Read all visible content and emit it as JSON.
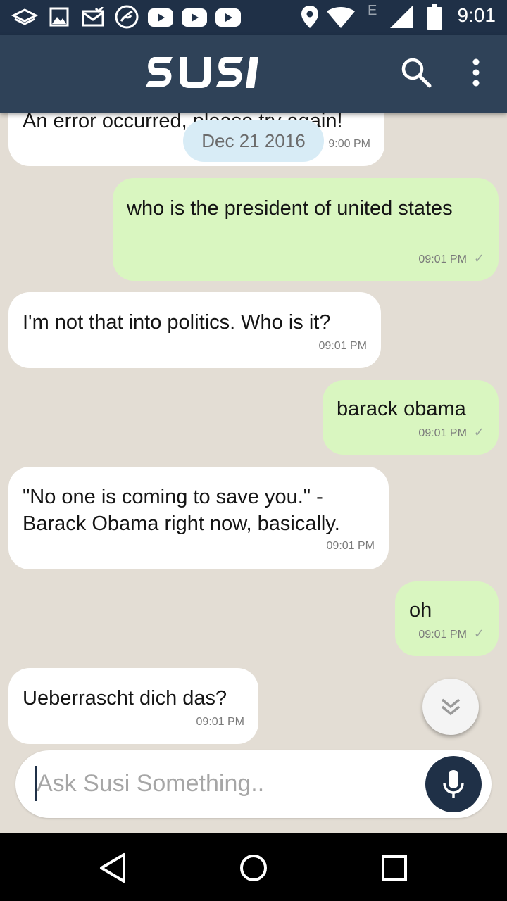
{
  "status_bar": {
    "time": "9:01",
    "network_letter": "E",
    "icons": [
      "layers-icon",
      "gallery-icon",
      "mail-icon",
      "swirl-app-icon",
      "youtube-icon",
      "youtube-icon",
      "youtube-icon",
      "location-icon",
      "wifi-icon",
      "signal-icon",
      "battery-icon"
    ]
  },
  "app_bar": {
    "logo_text": "SUSI",
    "icons": [
      "search-icon",
      "more-vert-icon"
    ]
  },
  "chat": {
    "date_chip": "Dec 21 2016",
    "messages": [
      {
        "sender": "bot",
        "text": "An error occurred, please try again!",
        "time": "9:00 PM"
      },
      {
        "sender": "user",
        "text": "who is the president of united states",
        "time": "09:01 PM",
        "status_icon": "check-icon"
      },
      {
        "sender": "bot",
        "text": "I'm not that into politics. Who is it?",
        "time": "09:01 PM"
      },
      {
        "sender": "user",
        "text": "barack obama",
        "time": "09:01 PM",
        "status_icon": "check-icon"
      },
      {
        "sender": "bot",
        "text": "\"No one is coming to save you.\" - Barack Obama right now, basically.",
        "time": "09:01 PM"
      },
      {
        "sender": "user",
        "text": "oh",
        "time": "09:01 PM",
        "status_icon": "check-icon"
      },
      {
        "sender": "bot",
        "text": "Ueberrascht dich das?",
        "time": "09:01 PM"
      }
    ]
  },
  "input": {
    "placeholder": "Ask Susi Something..",
    "mic_icon": "mic-icon"
  },
  "scroll_button_icon": "double-chevron-down-icon",
  "nav_bar": {
    "icons": [
      "back-icon",
      "home-icon",
      "recents-icon"
    ]
  },
  "colors": {
    "status_bar": "#1f3047",
    "app_bar": "#2f4258",
    "chat_background": "#e3ddd4",
    "user_bubble": "#d9f6c0",
    "bot_bubble": "#ffffff",
    "date_chip": "#d8ecf6",
    "mic_button": "#1f3047"
  }
}
